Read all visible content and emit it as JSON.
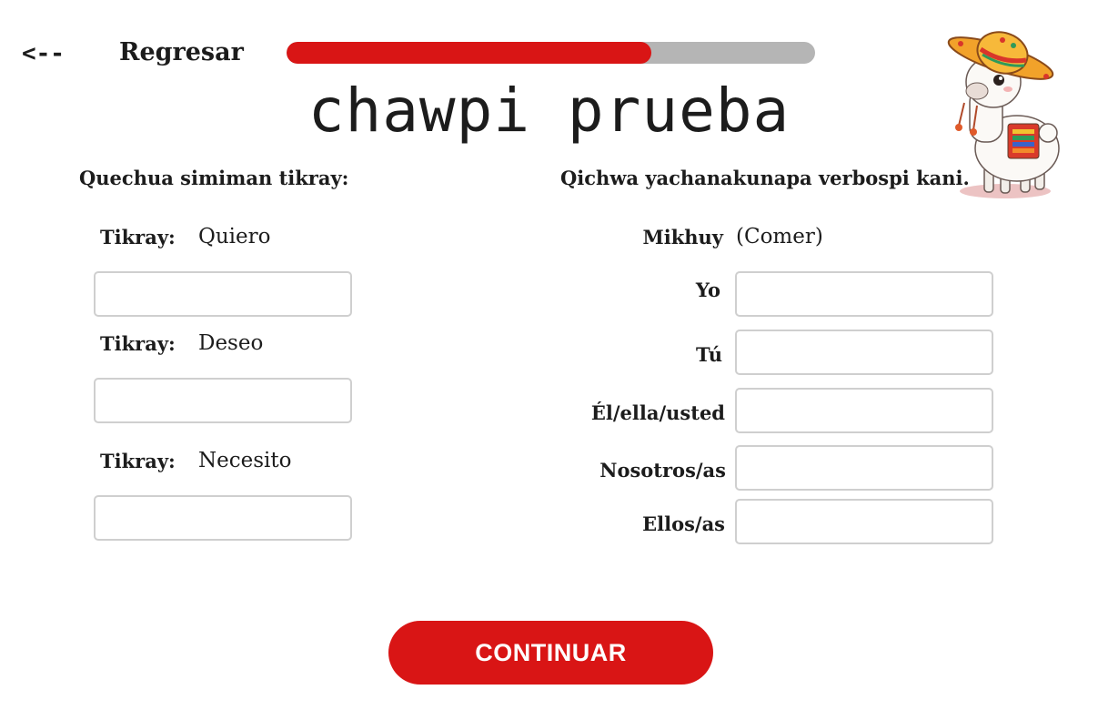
{
  "header": {
    "back_arrow": "<--",
    "back_label": "Regresar",
    "progress_fraction": 0.69
  },
  "title": "chawpi prueba",
  "left_section": {
    "heading": "Quechua simiman tikray:",
    "items": [
      {
        "label": "Tikray:",
        "word": "Quiero",
        "value": ""
      },
      {
        "label": "Tikray:",
        "word": "Deseo",
        "value": ""
      },
      {
        "label": "Tikray:",
        "word": "Necesito",
        "value": ""
      }
    ]
  },
  "right_section": {
    "heading": "Qichwa yachanakunapa verbospi kani.",
    "verb": "Mikhuy",
    "verb_gloss": "(Comer)",
    "pronouns": [
      {
        "label": "Yo",
        "value": ""
      },
      {
        "label": "Tú",
        "value": ""
      },
      {
        "label": "Él/ella/usted",
        "value": ""
      },
      {
        "label": "Nosotros/as",
        "value": ""
      },
      {
        "label": "Ellos/as",
        "value": ""
      }
    ]
  },
  "continue_label": "CONTINUAR",
  "mascot_icon": "llama-with-sombrero-icon",
  "colors": {
    "accent": "#d91515",
    "progress_track": "#b5b5b5",
    "input_border": "#cfcfcf"
  }
}
